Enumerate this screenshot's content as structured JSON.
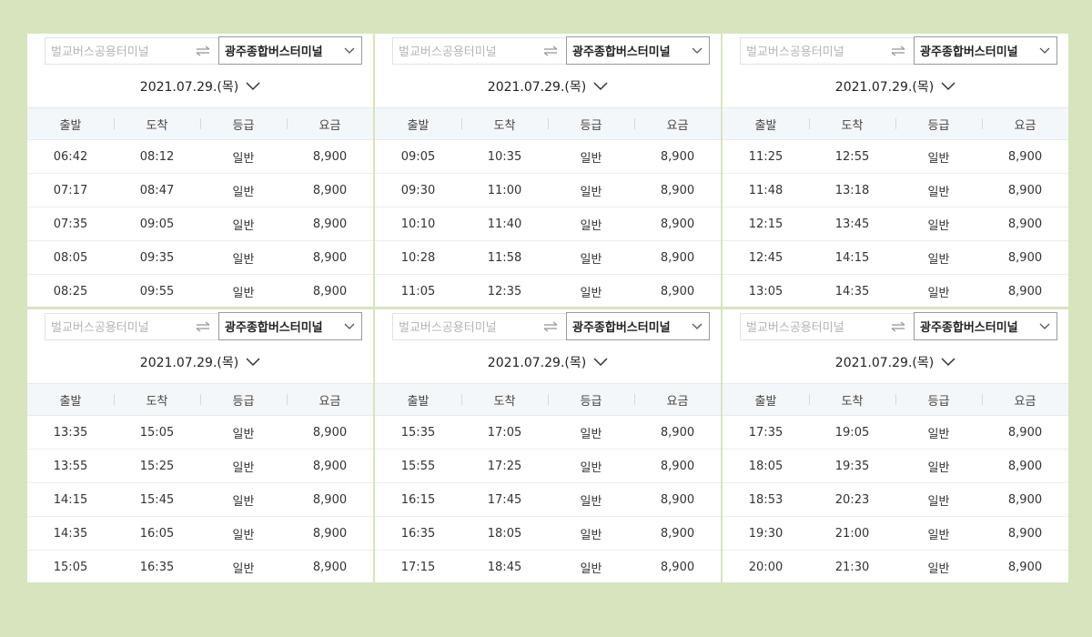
{
  "headers": [
    "출발",
    "도착",
    "등급",
    "요금"
  ],
  "panels": [
    {
      "origin_placeholder": "벌교버스공용터미널",
      "destination": "광주종합버스터미널",
      "date": "2021.07.29.(목)",
      "rows": [
        [
          "06:42",
          "08:12",
          "일반",
          "8,900"
        ],
        [
          "07:17",
          "08:47",
          "일반",
          "8,900"
        ],
        [
          "07:35",
          "09:05",
          "일반",
          "8,900"
        ],
        [
          "08:05",
          "09:35",
          "일반",
          "8,900"
        ],
        [
          "08:25",
          "09:55",
          "일반",
          "8,900"
        ]
      ]
    },
    {
      "origin_placeholder": "벌교버스공용터미널",
      "destination": "광주종합버스터미널",
      "date": "2021.07.29.(목)",
      "rows": [
        [
          "09:05",
          "10:35",
          "일반",
          "8,900"
        ],
        [
          "09:30",
          "11:00",
          "일반",
          "8,900"
        ],
        [
          "10:10",
          "11:40",
          "일반",
          "8,900"
        ],
        [
          "10:28",
          "11:58",
          "일반",
          "8,900"
        ],
        [
          "11:05",
          "12:35",
          "일반",
          "8,900"
        ]
      ]
    },
    {
      "origin_placeholder": "벌교버스공용터미널",
      "destination": "광주종합버스터미널",
      "date": "2021.07.29.(목)",
      "rows": [
        [
          "11:25",
          "12:55",
          "일반",
          "8,900"
        ],
        [
          "11:48",
          "13:18",
          "일반",
          "8,900"
        ],
        [
          "12:15",
          "13:45",
          "일반",
          "8,900"
        ],
        [
          "12:45",
          "14:15",
          "일반",
          "8,900"
        ],
        [
          "13:05",
          "14:35",
          "일반",
          "8,900"
        ]
      ]
    },
    {
      "origin_placeholder": "벌교버스공용터미널",
      "destination": "광주종합버스터미널",
      "date": "2021.07.29.(목)",
      "rows": [
        [
          "13:35",
          "15:05",
          "일반",
          "8,900"
        ],
        [
          "13:55",
          "15:25",
          "일반",
          "8,900"
        ],
        [
          "14:15",
          "15:45",
          "일반",
          "8,900"
        ],
        [
          "14:35",
          "16:05",
          "일반",
          "8,900"
        ],
        [
          "15:05",
          "16:35",
          "일반",
          "8,900"
        ]
      ]
    },
    {
      "origin_placeholder": "벌교버스공용터미널",
      "destination": "광주종합버스터미널",
      "date": "2021.07.29.(목)",
      "rows": [
        [
          "15:35",
          "17:05",
          "일반",
          "8,900"
        ],
        [
          "15:55",
          "17:25",
          "일반",
          "8,900"
        ],
        [
          "16:15",
          "17:45",
          "일반",
          "8,900"
        ],
        [
          "16:35",
          "18:05",
          "일반",
          "8,900"
        ],
        [
          "17:15",
          "18:45",
          "일반",
          "8,900"
        ]
      ]
    },
    {
      "origin_placeholder": "벌교버스공용터미널",
      "destination": "광주종합버스터미널",
      "date": "2021.07.29.(목)",
      "rows": [
        [
          "17:35",
          "19:05",
          "일반",
          "8,900"
        ],
        [
          "18:05",
          "19:35",
          "일반",
          "8,900"
        ],
        [
          "18:53",
          "20:23",
          "일반",
          "8,900"
        ],
        [
          "19:30",
          "21:00",
          "일반",
          "8,900"
        ],
        [
          "20:00",
          "21:30",
          "일반",
          "8,900"
        ]
      ]
    }
  ],
  "icons": {
    "swap": "swap-arrows-icon",
    "dropdown": "chevron-down-icon"
  },
  "colors": {
    "page_background": "#d7e4bd",
    "table_header_background": "#f4f7f9"
  }
}
